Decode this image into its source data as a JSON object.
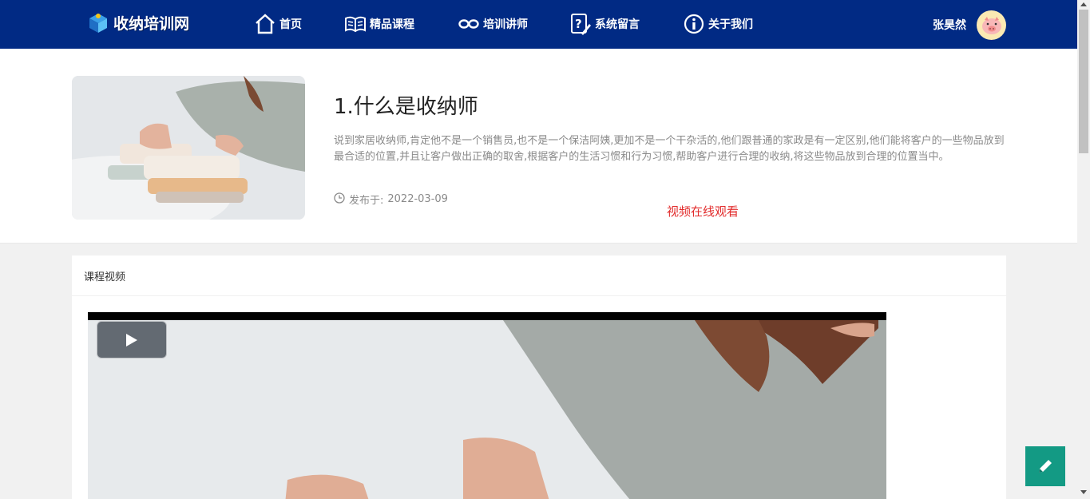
{
  "navbar": {
    "logo_text": "收纳培训网",
    "items": [
      {
        "label": "首页",
        "icon": "home-icon"
      },
      {
        "label": "精品课程",
        "icon": "book-icon"
      },
      {
        "label": "培训讲师",
        "icon": "mask-icon"
      },
      {
        "label": "系统留言",
        "icon": "question-edit-icon"
      },
      {
        "label": "关于我们",
        "icon": "info-icon"
      }
    ],
    "user_name": "张昊然"
  },
  "course": {
    "title": "1.什么是收纳师",
    "description": "说到家居收纳师,肯定他不是一个销售员,也不是一个保洁阿姨,更加不是一个干杂活的,他们跟普通的家政是有一定区别,他们能将客户的一些物品放到最合适的位置,并且让客户做出正确的取舍,根据客户的生活习惯和行为习惯,帮助客户进行合理的收纳,将这些物品放到合理的位置当中。",
    "publish_label": "发布于:",
    "publish_date": "2022-03-09",
    "watch_link": "视频在线观看"
  },
  "video_card": {
    "title": "课程视频"
  },
  "colors": {
    "navbar_bg": "#012a84",
    "accent_red": "#e22c2c",
    "fab_green": "#139a84"
  }
}
